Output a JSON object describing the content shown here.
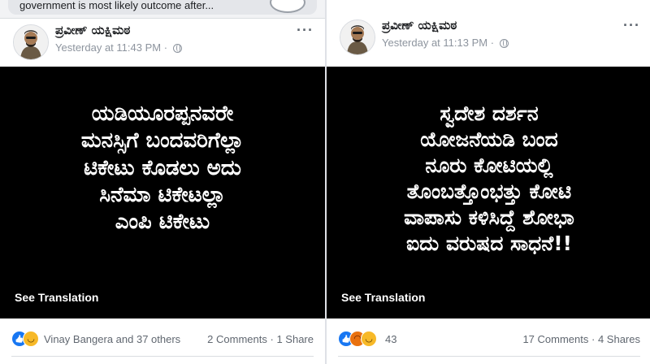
{
  "top_strip": {
    "snippet_text": "government is most likely outcome after..."
  },
  "left_post": {
    "author": "ಪ್ರವೀಣ್ ಯಕ್ಷಿಮಠ",
    "timestamp": "Yesterday at 11:43 PM",
    "separator": "·",
    "image_lines": [
      "ಯಡಿಯೂರಪ್ಪನವರೇ",
      "ಮನಸ್ಸಿಗೆ ಬಂದವರಿಗೆಲ್ಲಾ",
      "ಟಿಕೇಟು ಕೊಡಲು ಅದು",
      "ಸಿನೆಮಾ ಟಿಕೇಟಲ್ಲಾ",
      "ಎಂಪಿ ಟಿಕೇಟು"
    ],
    "see_translation": "See Translation",
    "reactions_text": "Vinay Bangera and 37 others",
    "comments": "2 Comments",
    "dot": "·",
    "shares": "1 Share"
  },
  "right_post": {
    "author": "ಪ್ರವೀಣ್ ಯಕ್ಷಿಮಠ",
    "timestamp": "Yesterday at 11:13 PM",
    "separator": "·",
    "image_lines": [
      "ಸ್ವದೇಶ ದರ್ಶನ",
      "ಯೋಜನೆಯಡಿ ಬಂದ",
      "ನೂರು ಕೋಟಿಯಲ್ಲಿ",
      "ತೊಂಬತ್ತೊಂಭತ್ತು ಕೋಟಿ",
      "ವಾಪಾಸು ಕಳಿಸಿದ್ದೆ ಶೋಭಾ",
      "ಐದು ವರುಷದ ಸಾಧನೆ!!"
    ],
    "see_translation": "See Translation",
    "reactions_count": "43",
    "comments": "17 Comments",
    "dot": "·",
    "shares": "4 Shares"
  },
  "colors": {
    "like_blue": "#1877f2",
    "haha_yellow": "#f7b928",
    "angry_orange": "#e9710f",
    "meta_gray": "#8d949e",
    "card_black": "#000000"
  },
  "icons": [
    "like-icon",
    "haha-icon",
    "angry-icon",
    "globe-icon",
    "more-options-icon"
  ]
}
